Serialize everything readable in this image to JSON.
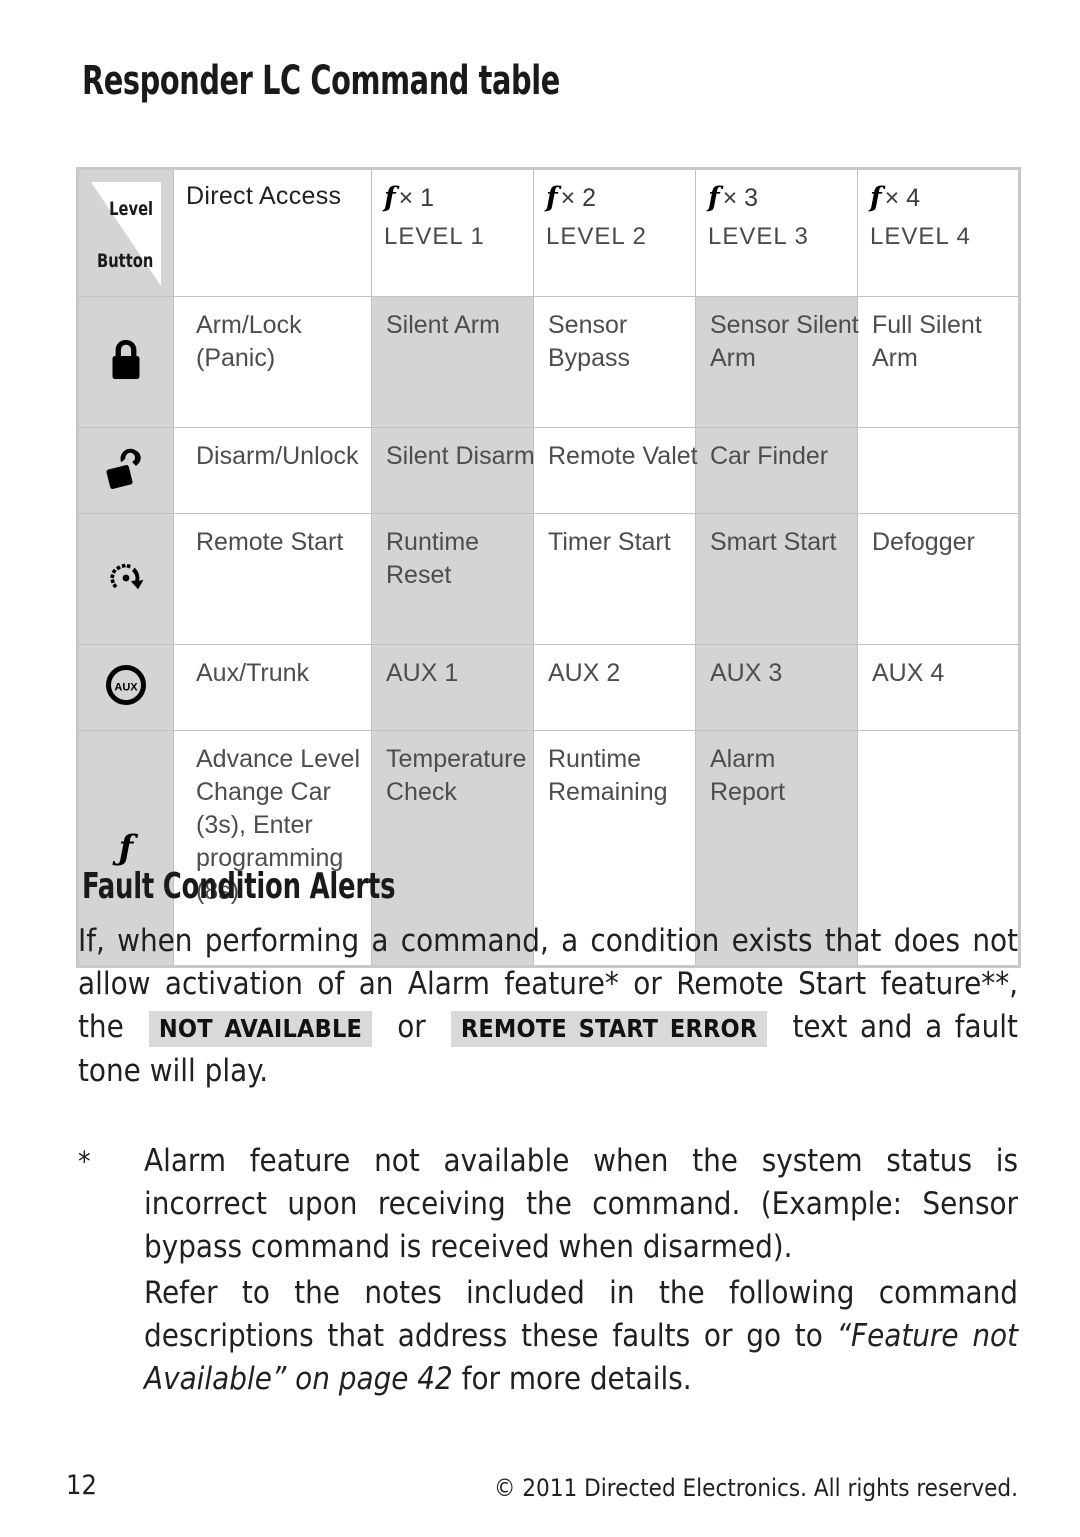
{
  "page": {
    "title": "Responder LC Command table",
    "footer_page_number": "12",
    "footer_copyright": "© 2011 Directed Electronics. All rights reserved."
  },
  "table": {
    "corner": {
      "level_label": "Level",
      "button_label": "Button"
    },
    "headers": {
      "direct_access": "Direct Access",
      "levels": [
        {
          "multiplier": "× 1",
          "name": "LEVEL 1",
          "glyph": "f"
        },
        {
          "multiplier": "× 2",
          "name": "LEVEL 2",
          "glyph": "f"
        },
        {
          "multiplier": "× 3",
          "name": "LEVEL 3",
          "glyph": "f"
        },
        {
          "multiplier": "× 4",
          "name": "LEVEL 4",
          "glyph": "f"
        }
      ]
    },
    "rows": [
      {
        "icon": "lock-closed-icon",
        "direct": [
          "Arm/Lock",
          "(Panic)"
        ],
        "level1": [
          "Silent Arm"
        ],
        "level2": [
          "Sensor",
          "Bypass"
        ],
        "level3": [
          "Sensor Silent",
          "Arm"
        ],
        "level4": [
          "Full Silent",
          "Arm"
        ]
      },
      {
        "icon": "lock-open-icon",
        "direct": [
          "Disarm/Unlock"
        ],
        "level1": [
          "Silent Disarm"
        ],
        "level2": [
          "Remote Valet"
        ],
        "level3": [
          "Car Finder"
        ],
        "level4": []
      },
      {
        "icon": "remote-start-icon",
        "direct": [
          "Remote Start"
        ],
        "level1": [
          "Runtime",
          "Reset"
        ],
        "level2": [
          "Timer Start"
        ],
        "level3": [
          "Smart Start"
        ],
        "level4": [
          "Defogger"
        ]
      },
      {
        "icon": "aux-icon",
        "direct": [
          "Aux/Trunk"
        ],
        "level1": [
          "AUX 1"
        ],
        "level2": [
          "AUX 2"
        ],
        "level3": [
          "AUX 3"
        ],
        "level4": [
          "AUX 4"
        ]
      },
      {
        "icon": "function-f-icon",
        "direct": [
          "Advance Level",
          "Change Car",
          "(3s), Enter",
          "programming",
          "(8s)"
        ],
        "level1": [
          "Temperature",
          "Check"
        ],
        "level2": [
          "Runtime",
          "Remaining"
        ],
        "level3": [
          "Alarm",
          "Report"
        ],
        "level4": []
      }
    ]
  },
  "fault_section": {
    "title": "Fault Condition Alerts",
    "intro_part1": "If, when performing a command, a condition exists that does not allow activation of an Alarm feature* or Remote Start feature**, the",
    "badge_not_available": "NOT AVAILABLE",
    "intro_or": "or",
    "badge_remote_start_error": "REMOTE START ERROR",
    "intro_part2": "text and a fault tone will play.",
    "notes": [
      {
        "marker": "*",
        "text": "Alarm feature not available when the system status is incorrect upon receiving the command. (Example: Sensor bypass command is received when disarmed)."
      },
      {
        "marker": "",
        "text_before": "Refer to the notes included in the following command descriptions that address these faults or go to",
        "text_italic": "“Feature not Available” on page 42",
        "text_after": "for more details."
      }
    ]
  },
  "colors": {
    "shade": "#d4d4d4",
    "badge_bg": "#d9d9d9",
    "text": "#231f20",
    "cell_text": "#4d4d4d",
    "border": "#c2c2c2"
  }
}
